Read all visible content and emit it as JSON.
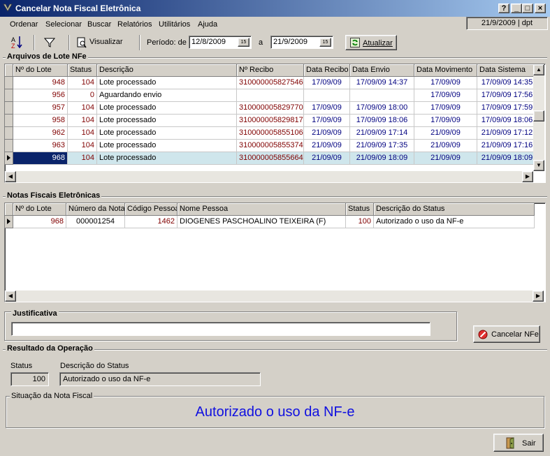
{
  "window": {
    "title": "Cancelar Nota Fiscal Eletrônica",
    "caption_buttons": [
      "?",
      "_",
      "□",
      "×"
    ]
  },
  "menu": {
    "items": [
      "Ordenar",
      "Selecionar",
      "Buscar",
      "Relatórios",
      "Utilitários",
      "Ajuda"
    ]
  },
  "status_date": "21/9/2009 | dpt",
  "toolbar": {
    "visualizar": "Visualizar",
    "periodo_label": "Período: de",
    "date_from": "12/8/2009",
    "a_label": "a",
    "date_to": "21/9/2009",
    "atualizar": "Atualizar"
  },
  "lotes": {
    "title": "Arquivos de Lote NFe",
    "headers": [
      "Nº do Lote",
      "Status",
      "Descrição",
      "Nº Recibo",
      "Data Recibo",
      "Data Envio",
      "Data Movimento",
      "Data Sistema"
    ],
    "rows": [
      [
        "948",
        "104",
        "Lote processado",
        "310000005827546",
        "17/09/09",
        "17/09/09 14:37",
        "17/09/09",
        "17/09/09 14:35"
      ],
      [
        "956",
        "0",
        "Aguardando envio",
        "",
        "",
        "",
        "17/09/09",
        "17/09/09 17:56"
      ],
      [
        "957",
        "104",
        "Lote processado",
        "310000005829770",
        "17/09/09",
        "17/09/09 18:00",
        "17/09/09",
        "17/09/09 17:59"
      ],
      [
        "958",
        "104",
        "Lote processado",
        "310000005829817",
        "17/09/09",
        "17/09/09 18:06",
        "17/09/09",
        "17/09/09 18:06"
      ],
      [
        "962",
        "104",
        "Lote processado",
        "310000005855106",
        "21/09/09",
        "21/09/09 17:14",
        "21/09/09",
        "21/09/09 17:12"
      ],
      [
        "963",
        "104",
        "Lote processado",
        "310000005855374",
        "21/09/09",
        "21/09/09 17:35",
        "21/09/09",
        "21/09/09 17:16"
      ],
      [
        "968",
        "104",
        "Lote processado",
        "310000005855664",
        "21/09/09",
        "21/09/09 18:09",
        "21/09/09",
        "21/09/09 18:09"
      ]
    ]
  },
  "notas": {
    "title": "Notas Fiscais Eletrônicas",
    "headers": [
      "Nº do Lote",
      "Número da Nota",
      "Código Pessoa",
      "Nome Pessoa",
      "Status",
      "Descrição do Status"
    ],
    "rows": [
      [
        "968",
        "000001254",
        "1462",
        "DIOGENES PASCHOALINO TEIXEIRA (F)",
        "100",
        "Autorizado o uso da NF-e"
      ]
    ]
  },
  "justificativa": {
    "title": "Justificativa",
    "value": "",
    "cancelar_label": "Cancelar NFe"
  },
  "resultado": {
    "title": "Resultado da Operação",
    "status_label": "Status",
    "status_value": "100",
    "desc_label": "Descrição do Status",
    "desc_value": "Autorizado o uso da NF-e"
  },
  "situacao": {
    "title": "Situação da Nota Fiscal",
    "message": "Autorizado o uso da NF-e",
    "color": "#1010e0"
  },
  "sair_label": "Sair"
}
